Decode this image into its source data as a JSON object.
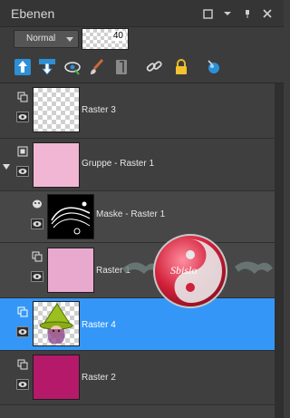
{
  "panel": {
    "title": "Ebenen"
  },
  "blend": {
    "mode": "Normal",
    "opacity": "40"
  },
  "toolbar_icons": [
    "new-raster-layer-icon",
    "new-vector-layer-icon",
    "eye-view-icon",
    "brush-icon",
    "mask-icon",
    "link-icon",
    "lock-icon",
    "fill-icon"
  ],
  "layers": [
    {
      "name": "Raster 3"
    },
    {
      "name": "Gruppe - Raster 1"
    },
    {
      "name": "Maske - Raster 1"
    },
    {
      "name": "Raster 1"
    },
    {
      "name": "Raster 4"
    },
    {
      "name": "Raster 2"
    }
  ],
  "colors": {
    "selection": "#3497f7",
    "pink": "#f4b9d8",
    "group_pink": "#f1b6d4",
    "raster1_pink": "#e9a9cf",
    "raster2_magenta": "#b5196a"
  },
  "watermark": {
    "text": "Sbislo"
  }
}
